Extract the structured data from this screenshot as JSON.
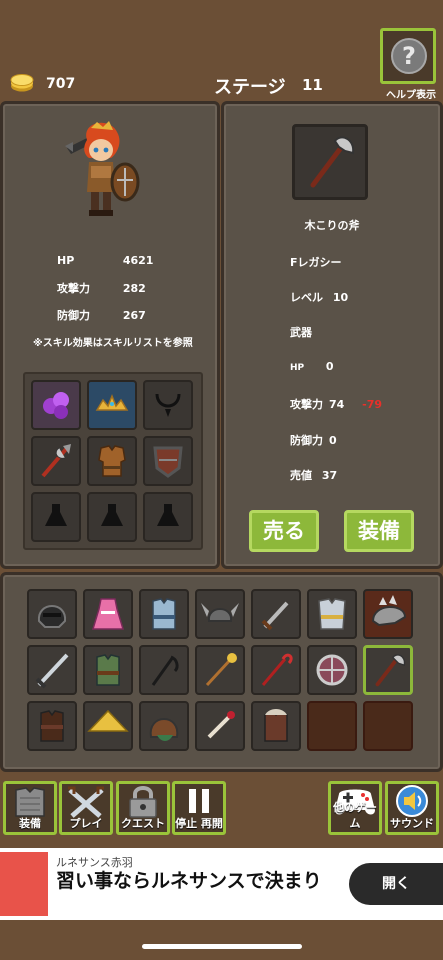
{
  "header": {
    "gold": "707",
    "stage_label": "ステージ",
    "stage_number": "11",
    "help_label": "ヘルプ表示",
    "help_symbol": "?"
  },
  "hero": {
    "stats": [
      {
        "label": "HP",
        "value": "4621"
      },
      {
        "label": "攻撃力",
        "value": "282"
      },
      {
        "label": "防御力",
        "value": "267"
      }
    ],
    "note": "※スキル効果はスキルリストを参照"
  },
  "item": {
    "name": "木こりの斧",
    "rarity": "Fレガシー",
    "level_label": "レベル",
    "level": "10",
    "category": "武器",
    "hp_label": "HP",
    "hp": "0",
    "attack_label": "攻撃力",
    "attack": "74",
    "attack_diff": "-79",
    "defense_label": "防御力",
    "defense": "0",
    "price_label": "売値",
    "price": "37",
    "sell_label": "売る",
    "equip_label": "装備"
  },
  "bottom_nav": {
    "equip": "装備",
    "play": "プレイ",
    "quest": "クエスト",
    "pause": "停止 再開",
    "other_games": "他のゲーム",
    "sound": "サウンド"
  },
  "ad": {
    "advertiser": "ルネサンス赤羽",
    "headline": "習い事ならルネサンスで決まり",
    "cta": "開く"
  },
  "colors": {
    "accent_green": "#8db83a",
    "background_brown": "#6b4f36",
    "panel": "#5a5248",
    "negative_red": "#e8302a"
  }
}
